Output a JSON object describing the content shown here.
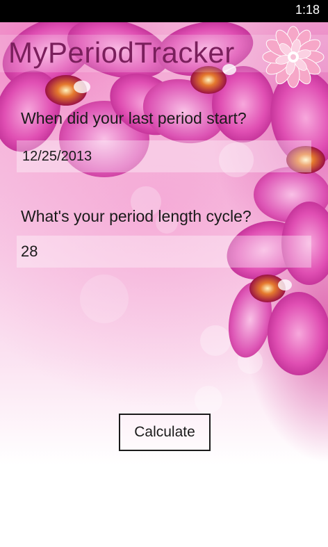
{
  "status_bar": {
    "time": "1:18"
  },
  "app": {
    "title": "MyPeriodTracker",
    "accent_color": "#7a1f5c"
  },
  "form": {
    "last_period_label": "When did your last period start?",
    "last_period_value": "12/25/2013",
    "cycle_length_label": "What's your period length cycle?",
    "cycle_length_value": "28",
    "calculate_label": "Calculate"
  },
  "icons": {
    "logo": "pink-flower-icon",
    "background": "orchid-background"
  }
}
